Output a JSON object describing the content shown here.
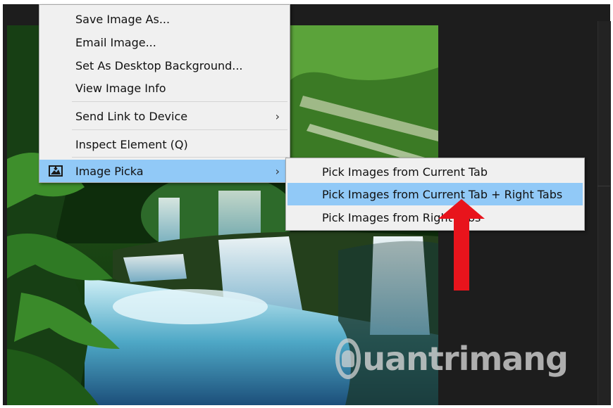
{
  "context_menu": {
    "items": [
      {
        "label": "Save Image As...",
        "has_submenu": false
      },
      {
        "label": "Email Image...",
        "has_submenu": false
      },
      {
        "label": "Set As Desktop Background...",
        "has_submenu": false
      },
      {
        "label": "View Image Info",
        "has_submenu": false
      },
      {
        "label": "Send Link to Device",
        "has_submenu": true,
        "arrow": "›"
      },
      {
        "label": "Inspect Element (Q)",
        "has_submenu": false
      },
      {
        "label": "Image Picka",
        "has_submenu": true,
        "arrow": "›",
        "icon": "image-picka-icon",
        "highlighted": true
      }
    ]
  },
  "submenu": {
    "items": [
      {
        "label": "Pick Images from Current Tab"
      },
      {
        "label": "Pick Images from Current Tab + Right Tabs",
        "highlighted": true
      },
      {
        "label": "Pick Images from Right Tabs"
      }
    ]
  },
  "watermark": {
    "text": "uantrimang",
    "icon": "lightbulb-icon"
  },
  "colors": {
    "highlight": "#91c9f7",
    "menu_bg": "#f0f0f0",
    "arrow_red": "#e8141c",
    "browser_bg": "#1d1d1d"
  }
}
